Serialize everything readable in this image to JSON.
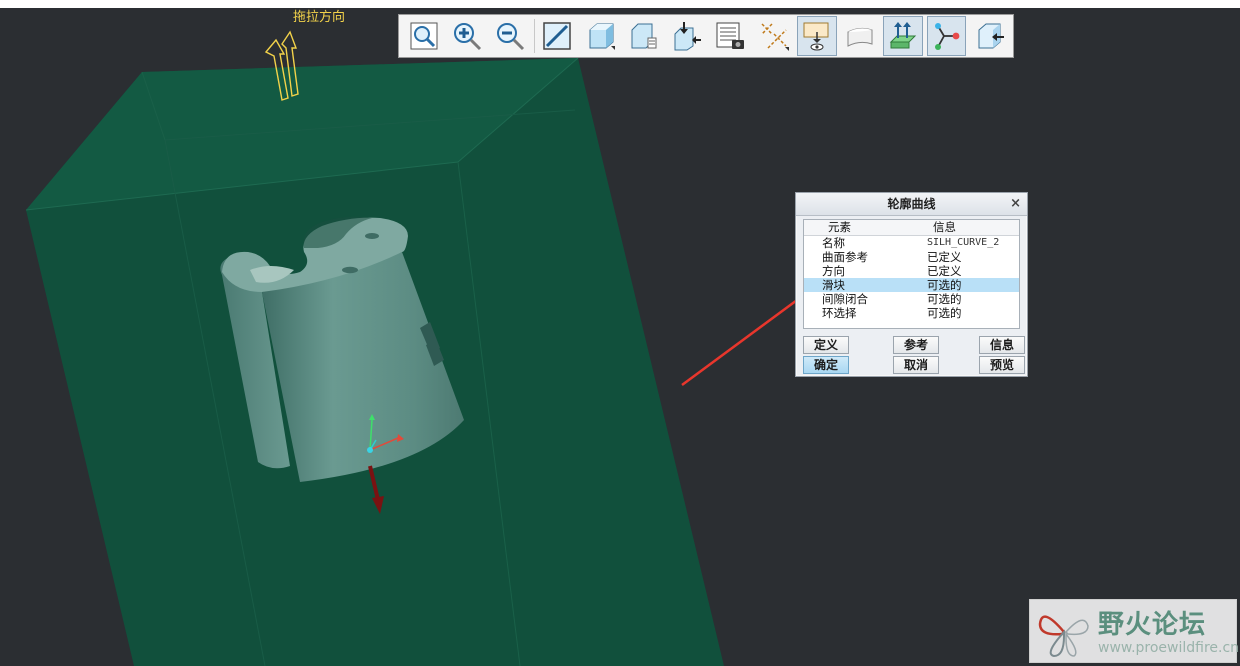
{
  "viewport": {
    "drag_direction_label": "拖拉方向"
  },
  "toolbar": {
    "buttons": [
      {
        "icon": "zoom-window-icon",
        "pressed": false
      },
      {
        "icon": "zoom-in-icon",
        "pressed": false
      },
      {
        "icon": "zoom-out-icon",
        "pressed": false
      },
      {
        "icon": "refit-icon",
        "pressed": false
      },
      {
        "icon": "shading-icon",
        "pressed": false
      },
      {
        "icon": "saved-views-icon",
        "pressed": false
      },
      {
        "icon": "reorient-icon",
        "pressed": false
      },
      {
        "icon": "view-manager-icon",
        "pressed": false
      },
      {
        "icon": "datum-display-icon",
        "pressed": false
      },
      {
        "icon": "display-filter-icon",
        "pressed": true
      },
      {
        "icon": "surface-display-icon",
        "pressed": false
      },
      {
        "icon": "pull-direction-icon",
        "pressed": true
      },
      {
        "icon": "connect-points-icon",
        "pressed": true
      },
      {
        "icon": "annotation-plane-icon",
        "pressed": false
      }
    ]
  },
  "dialog": {
    "title": "轮廓曲线",
    "close_glyph": "×",
    "columns": {
      "element": "元素",
      "info": "信息"
    },
    "rows": [
      {
        "element": "名称",
        "info": "SILH_CURVE_2",
        "mono": true
      },
      {
        "element": "曲面参考",
        "info": "已定义"
      },
      {
        "element": "方向",
        "info": "已定义"
      },
      {
        "element": "滑块",
        "info": "可选的",
        "selected": true
      },
      {
        "element": "间隙闭合",
        "info": "可选的"
      },
      {
        "element": "环选择",
        "info": "可选的"
      }
    ],
    "buttons": {
      "define": "定义",
      "refs": "参考",
      "info": "信息",
      "ok": "确定",
      "cancel": "取消",
      "preview": "预览"
    }
  },
  "watermark": {
    "title": "野火论坛",
    "url": "www.proewildfire.cn"
  },
  "colors": {
    "background": "#2b2e32",
    "block": "#11503c",
    "part": "#5e9088",
    "annotation_arrow": "#e8362c",
    "label_yellow": "#f2d24a"
  }
}
